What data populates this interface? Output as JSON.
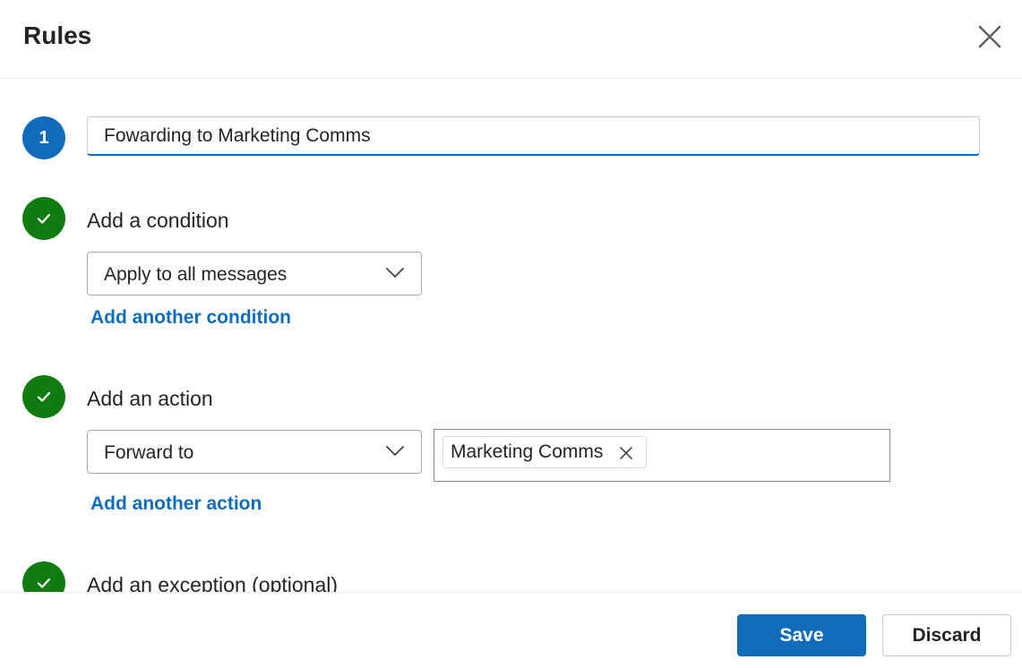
{
  "dialog": {
    "title": "Rules",
    "close_icon": "close-icon"
  },
  "rule": {
    "step_number": "1",
    "name_value": "Fowarding to Marketing Comms"
  },
  "condition": {
    "label": "Add a condition",
    "selected": "Apply to all messages",
    "add_link": "Add another condition"
  },
  "action": {
    "label": "Add an action",
    "selected": "Forward to",
    "recipients": [
      "Marketing Comms"
    ],
    "add_link": "Add another action"
  },
  "exception": {
    "label": "Add an exception (optional)"
  },
  "footer": {
    "save_label": "Save",
    "discard_label": "Discard"
  },
  "colors": {
    "accent": "#0f6cbd",
    "success": "#107c10"
  },
  "icons": [
    "close-icon",
    "checkmark-icon",
    "chevron-down-icon",
    "remove-icon"
  ]
}
